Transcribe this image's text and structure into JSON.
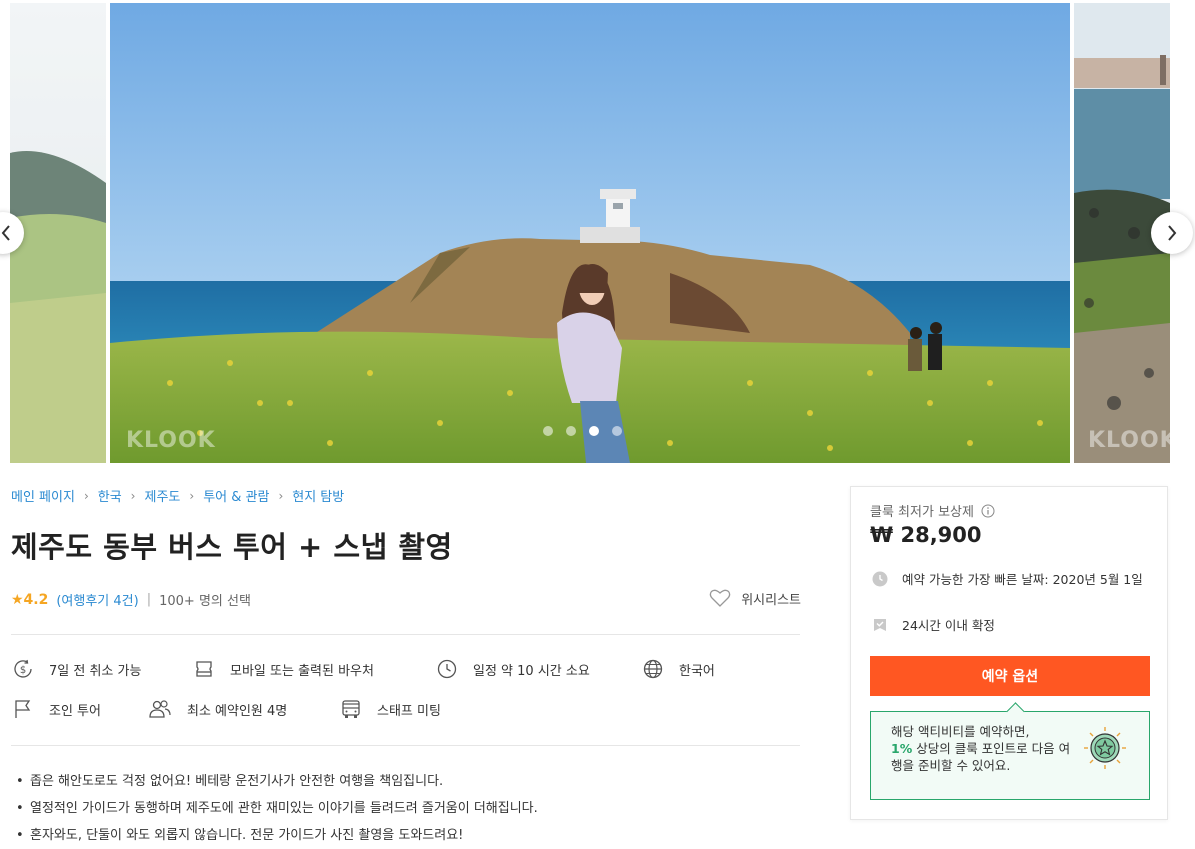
{
  "gallery": {
    "watermark": "KLOOK",
    "active_index": 2,
    "slide_count": 4
  },
  "breadcrumb": [
    "메인 페이지",
    "한국",
    "제주도",
    "투어 & 관람",
    "현지 탐방"
  ],
  "title": "제주도 동부 버스 투어 + 스냅 촬영",
  "rating": {
    "score": "★4.2",
    "reviews": "(여행후기 4건)",
    "separator": "|",
    "booked": "100+ 명의 선택"
  },
  "wishlist_label": "위시리스트",
  "features": [
    {
      "icon": "dollar-cancel-icon",
      "label": "7일 전 취소 가능"
    },
    {
      "icon": "ticket-icon",
      "label": "모바일 또는 출력된 바우처"
    },
    {
      "icon": "clock-icon",
      "label": "일정 약 10 시간 소요"
    },
    {
      "icon": "globe-icon",
      "label": "한국어"
    },
    {
      "icon": "flag-icon",
      "label": "조인 투어"
    },
    {
      "icon": "group-icon",
      "label": "최소 예약인원 4명"
    },
    {
      "icon": "bus-icon",
      "label": "스태프 미팅"
    }
  ],
  "bullets": [
    "좁은 해안도로도 걱정 없어요! 베테랑 운전기사가 안전한 여행을 책임집니다.",
    "열정적인 가이드가 동행하며 제주도에 관한 재미있는 이야기를 들려드려 즐거움이 더해집니다.",
    "혼자와도, 단둘이 와도 외롭지 않습니다. 전문 가이드가 사진 촬영을 도와드려요!"
  ],
  "booking": {
    "best_price_label": "클룩 최저가 보상제",
    "price": "₩ 28,900",
    "earliest_date": "예약 가능한 가장 빠른 날짜: 2020년 5월 1일",
    "confirmation": "24시간 이내 확정",
    "button_label": "예약 옵션",
    "reward_pre": "해당 액티비티를 예약하면,",
    "reward_pct": "1%",
    "reward_post": "상당의 클룩 포인트로 다음 여행을 준비할 수 있어요.",
    "accent_color": "#ff5722",
    "reward_color": "#29a66b"
  }
}
